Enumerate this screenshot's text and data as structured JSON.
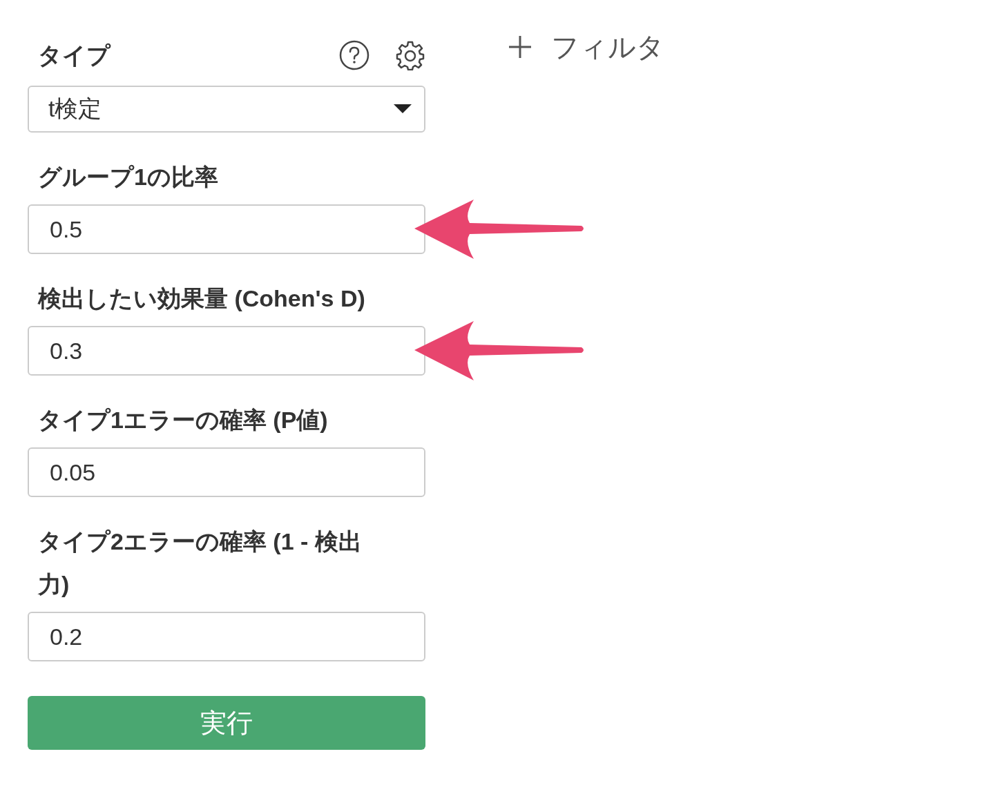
{
  "type_select": {
    "label": "タイプ",
    "value": "t検定"
  },
  "fields": [
    {
      "label": "グループ1の比率",
      "value": "0.5",
      "highlighted": true
    },
    {
      "label": "検出したい効果量 (Cohen's D)",
      "value": "0.3",
      "highlighted": true
    },
    {
      "label": "タイプ1エラーの確率 (P値)",
      "value": "0.05",
      "highlighted": false
    },
    {
      "label": "タイプ2エラーの確率 (1 - 検出力)",
      "value": "0.2",
      "highlighted": false
    }
  ],
  "run_button": {
    "label": "実行"
  },
  "filter_button": {
    "label": "フィルタ"
  }
}
